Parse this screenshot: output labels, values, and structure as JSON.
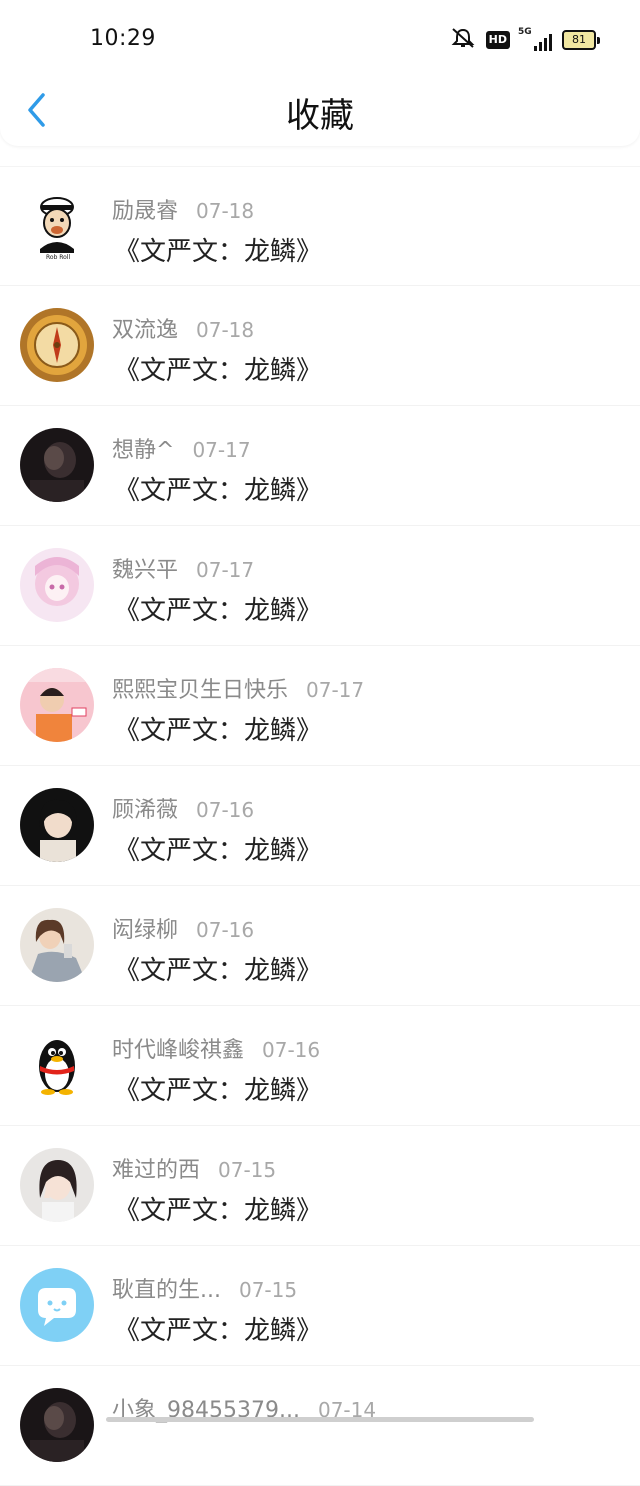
{
  "status": {
    "time": "10:29",
    "hd": "HD",
    "network": "5G",
    "battery": "81"
  },
  "header": {
    "title": "收藏",
    "back_icon": "chevron-left-icon",
    "accent": "#2f9be8"
  },
  "items": [
    {
      "name": "励晟睿",
      "date": "07-18",
      "title": "《文严文：龙鳞》",
      "avatar": "cartoon-man"
    },
    {
      "name": "双流逸",
      "date": "07-18",
      "title": "《文严文：龙鳞》",
      "avatar": "compass"
    },
    {
      "name": "想静^",
      "date": "07-17",
      "title": "《文严文：龙鳞》",
      "avatar": "dark-photo"
    },
    {
      "name": "魏兴平",
      "date": "07-17",
      "title": "《文严文：龙鳞》",
      "avatar": "anime-girl"
    },
    {
      "name": "熙熙宝贝生日快乐",
      "date": "07-17",
      "title": "《文严文：龙鳞》",
      "avatar": "pink-photo"
    },
    {
      "name": "顾浠薇",
      "date": "07-16",
      "title": "《文严文：龙鳞》",
      "avatar": "girl-photo"
    },
    {
      "name": "闳绿柳",
      "date": "07-16",
      "title": "《文严文：龙鳞》",
      "avatar": "woman-photo"
    },
    {
      "name": "时代峰峻祺鑫",
      "date": "07-16",
      "title": "《文严文：龙鳞》",
      "avatar": "penguin"
    },
    {
      "name": "难过的西",
      "date": "07-15",
      "title": "《文严文：龙鳞》",
      "avatar": "girl-selfie"
    },
    {
      "name": "耿直的生...",
      "date": "07-15",
      "title": "《文严文：龙鳞》",
      "avatar": "chat-bubble"
    },
    {
      "name": "小象_98455379...",
      "date": "07-14",
      "title": "",
      "avatar": "dark-photo"
    }
  ]
}
